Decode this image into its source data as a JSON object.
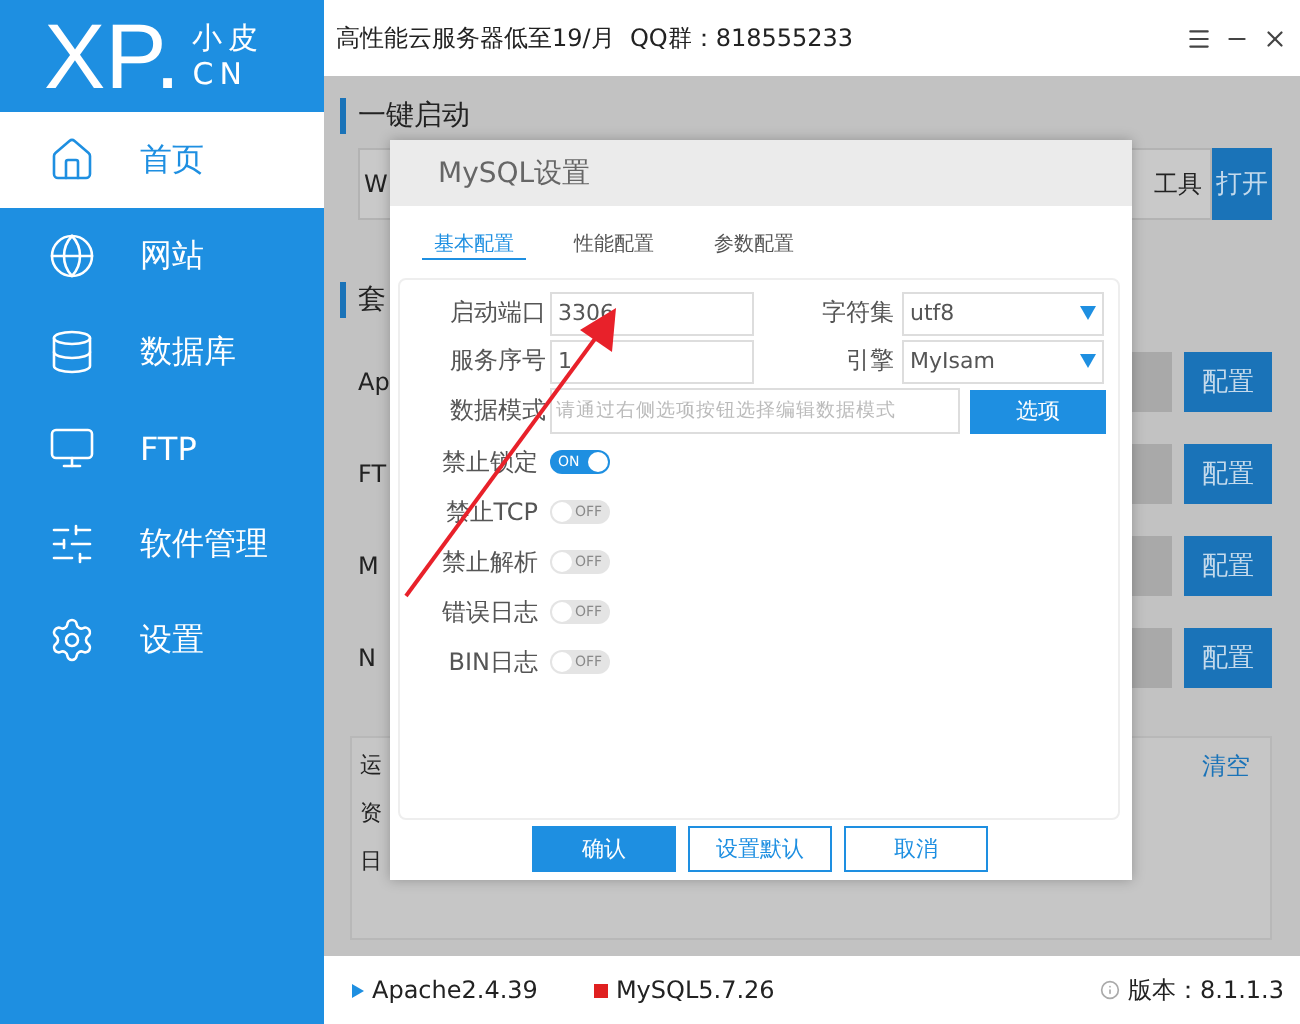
{
  "header": {
    "logo_main": "XP.",
    "logo_cn": "小皮",
    "logo_sub": "CN",
    "notice": "高性能云服务器低至19/月  QQ群：818555233"
  },
  "sidebar": {
    "items": [
      {
        "label": "首页",
        "selected": true
      },
      {
        "label": "网站",
        "selected": false
      },
      {
        "label": "数据库",
        "selected": false
      },
      {
        "label": "FTP",
        "selected": false
      },
      {
        "label": "软件管理",
        "selected": false
      },
      {
        "label": "设置",
        "selected": false
      }
    ]
  },
  "background": {
    "quick_start": {
      "title": "一键启动",
      "field": "W",
      "tool": "工具",
      "button": "打开"
    },
    "suite": {
      "title": "套",
      "rows": [
        {
          "label": "Ap",
          "button": "配置"
        },
        {
          "label": "FT",
          "button": "配置"
        },
        {
          "label": "M",
          "button": "配置"
        },
        {
          "label": "N",
          "button": "配置"
        }
      ]
    },
    "log": {
      "lines": [
        "运",
        "资",
        "日"
      ],
      "clear": "清空"
    }
  },
  "dialog": {
    "title": "MySQL设置",
    "tabs": [
      {
        "label": "基本配置",
        "selected": true
      },
      {
        "label": "性能配置",
        "selected": false
      },
      {
        "label": "参数配置",
        "selected": false
      }
    ],
    "fields": [
      {
        "label": "启动端口",
        "value": "3306",
        "select_label": "字符集",
        "select_value": "utf8"
      },
      {
        "label": "服务序号",
        "value": "1",
        "select_label": "引擎",
        "select_value": "MyIsam"
      }
    ],
    "data_mode": {
      "label": "数据模式",
      "placeholder": "请通过右侧选项按钮选择编辑数据模式",
      "button": "选项"
    },
    "switches": [
      {
        "label": "禁止锁定",
        "on": true,
        "text": "ON"
      },
      {
        "label": "禁止TCP",
        "on": false,
        "text": "OFF"
      },
      {
        "label": "禁止解析",
        "on": false,
        "text": "OFF"
      },
      {
        "label": "错误日志",
        "on": false,
        "text": "OFF"
      },
      {
        "label": "BIN日志",
        "on": false,
        "text": "OFF"
      }
    ],
    "buttons": [
      {
        "label": "确认",
        "primary": true
      },
      {
        "label": "设置默认",
        "primary": false
      },
      {
        "label": "取消",
        "primary": false
      }
    ]
  },
  "status_bar": {
    "services": [
      {
        "name": "Apache2.4.39",
        "running": false
      },
      {
        "name": "MySQL5.7.26",
        "running": true
      }
    ],
    "version": "版本：8.1.1.3"
  }
}
